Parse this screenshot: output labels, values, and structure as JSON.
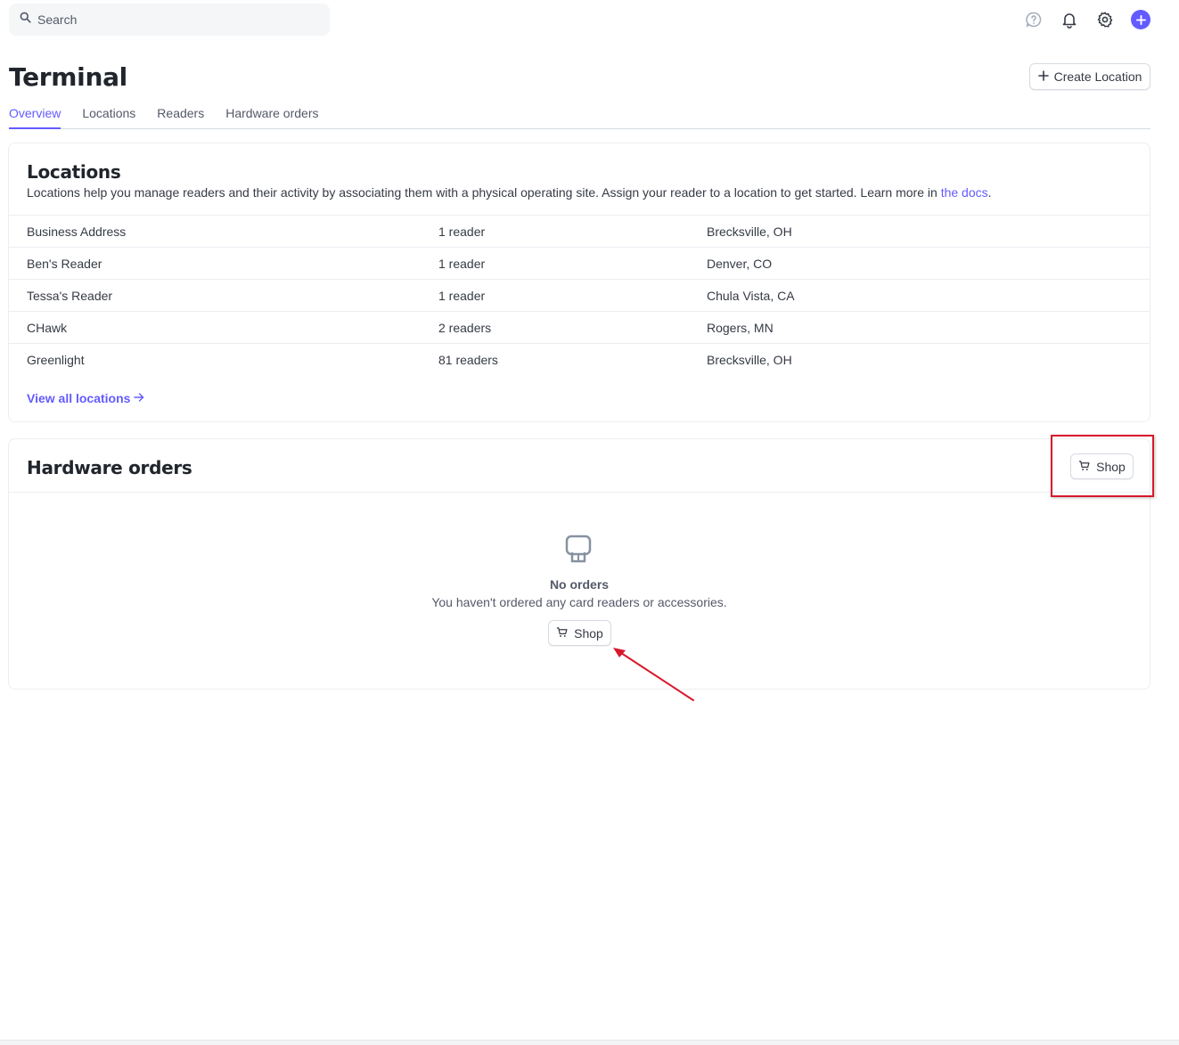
{
  "search": {
    "placeholder": "Search"
  },
  "header": {
    "title": "Terminal",
    "create_label": "Create Location"
  },
  "tabs": [
    {
      "label": "Overview",
      "active": true
    },
    {
      "label": "Locations",
      "active": false
    },
    {
      "label": "Readers",
      "active": false
    },
    {
      "label": "Hardware orders",
      "active": false
    }
  ],
  "locations": {
    "title": "Locations",
    "description": "Locations help you manage readers and their activity by associating them with a physical operating site. Assign your reader to a location to get started. Learn more in ",
    "docs_link": "the docs",
    "description_end": ".",
    "rows": [
      {
        "name": "Business Address",
        "readers": "1 reader",
        "place": "Brecksville, OH"
      },
      {
        "name": "Ben's Reader",
        "readers": "1 reader",
        "place": "Denver, CO"
      },
      {
        "name": "Tessa's Reader",
        "readers": "1 reader",
        "place": "Chula Vista, CA"
      },
      {
        "name": "CHawk",
        "readers": "2 readers",
        "place": "Rogers, MN"
      },
      {
        "name": "Greenlight",
        "readers": "81 readers",
        "place": "Brecksville, OH"
      }
    ],
    "view_all": "View all locations"
  },
  "hardware": {
    "title": "Hardware orders",
    "shop_label": "Shop",
    "empty_title": "No orders",
    "empty_subtitle": "You haven't ordered any card readers or accessories.",
    "empty_shop_label": "Shop"
  },
  "colors": {
    "accent": "#635bff",
    "annotation": "#d8182b"
  }
}
